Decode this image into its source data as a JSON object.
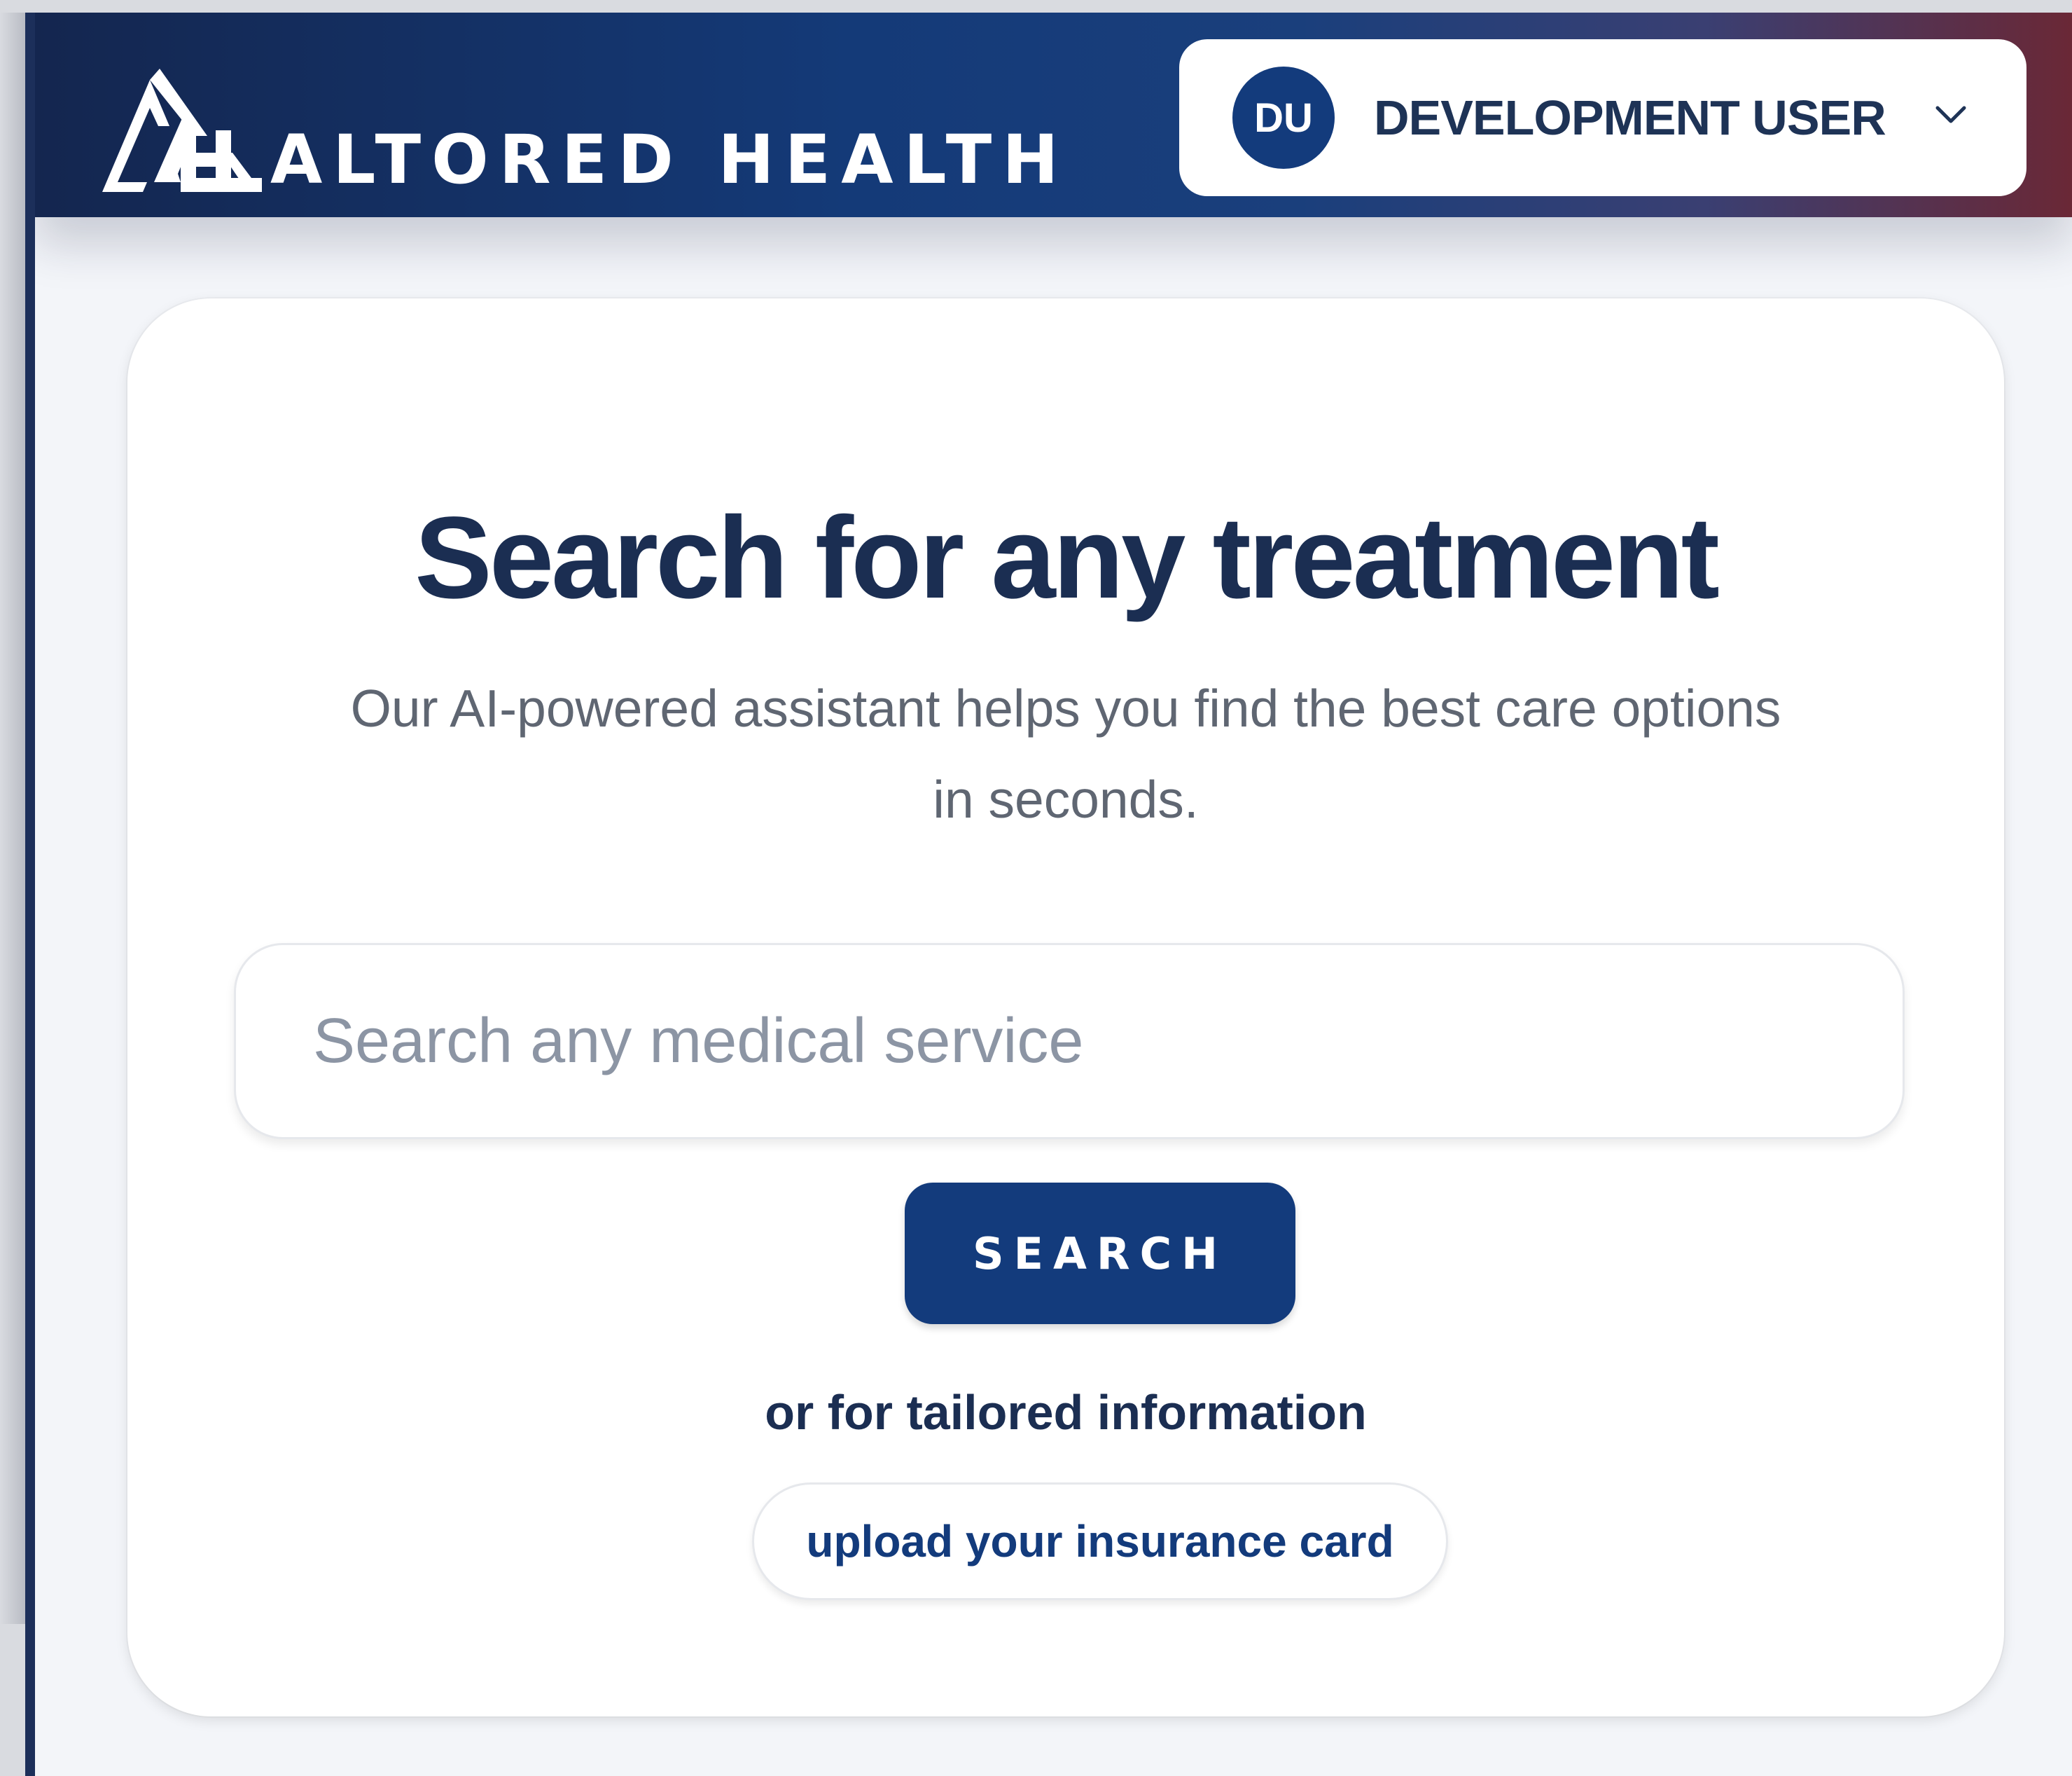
{
  "header": {
    "brand_name": "ALTORED HEALTH",
    "logo_icon": "altored-health-logo-icon",
    "user": {
      "initials": "DU",
      "name": "DEVELOPMENT USER",
      "menu_icon": "chevron-down-icon"
    }
  },
  "main": {
    "title": "Search for any treatment",
    "subtitle": "Our AI-powered assistant helps you find the best care options in seconds.",
    "search": {
      "value": "",
      "placeholder": "Search any medical service",
      "button_label": "SEARCH"
    },
    "alternative_text": "or for tailored information",
    "upload_label": "upload your insurance card"
  },
  "colors": {
    "primary": "#133b7c",
    "heading": "#1b2e52",
    "header_gradient_start": "#14264f",
    "header_gradient_end": "#6a2836",
    "background": "#f3f5f9"
  }
}
